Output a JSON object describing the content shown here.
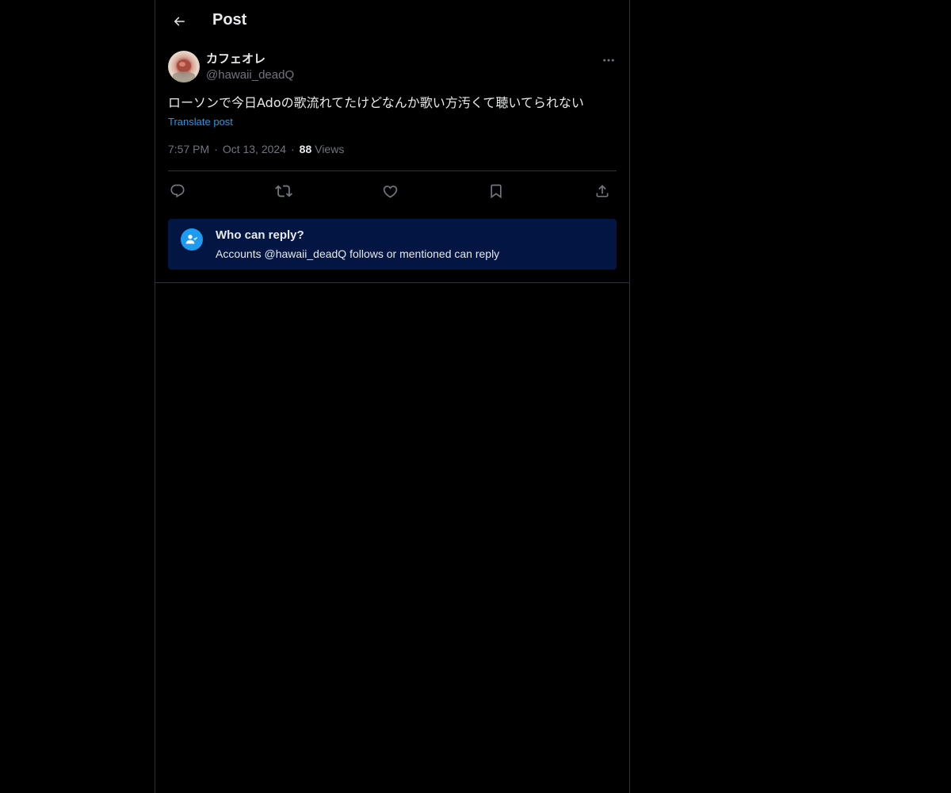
{
  "header": {
    "title": "Post",
    "back_icon": "arrow-left-icon"
  },
  "post": {
    "author": {
      "display_name": "カフェオレ",
      "handle": "@hawaii_deadQ"
    },
    "text": "ローソンで今日Adoの歌流れてたけどなんか歌い方汚くて聴いてられない",
    "translate_label": "Translate post",
    "time": "7:57 PM",
    "separator": "·",
    "date": "Oct 13, 2024",
    "views_count": "88",
    "views_label": "Views",
    "actions": {
      "reply_icon": "reply-icon",
      "repost_icon": "repost-icon",
      "like_icon": "heart-icon",
      "bookmark_icon": "bookmark-icon",
      "share_icon": "share-icon"
    }
  },
  "reply_restriction": {
    "title": "Who can reply?",
    "description": "Accounts @hawaii_deadQ follows or mentioned can reply"
  },
  "colors": {
    "background": "#000000",
    "text_primary": "#e7e9ea",
    "text_secondary": "#71767b",
    "accent": "#1d9bf0",
    "reply_box": "#031643",
    "border": "#2f3336"
  }
}
